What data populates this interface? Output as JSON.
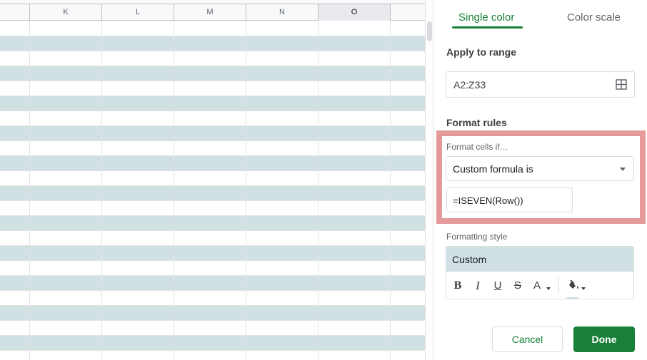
{
  "sheet": {
    "columns": [
      "K",
      "L",
      "M",
      "N",
      "O"
    ],
    "selected_column": "O",
    "row_fill_color": "#d0e0e3"
  },
  "panel": {
    "tabs": [
      {
        "label": "Single color",
        "active": true
      },
      {
        "label": "Color scale",
        "active": false
      }
    ],
    "apply_to_range_label": "Apply to range",
    "range_value": "A2:Z33",
    "format_rules_label": "Format rules",
    "format_cells_if_label": "Format cells if…",
    "condition_value": "Custom formula is",
    "formula_value": "=ISEVEN(Row())",
    "formatting_style_label": "Formatting style",
    "style_preview_label": "Custom",
    "style_tools": {
      "bold": "B",
      "italic": "I",
      "underline": "U",
      "strikethrough": "S",
      "text_color": "A"
    },
    "cancel_label": "Cancel",
    "done_label": "Done",
    "accent_color": "#188038",
    "highlight_color": "#e49a9a"
  }
}
